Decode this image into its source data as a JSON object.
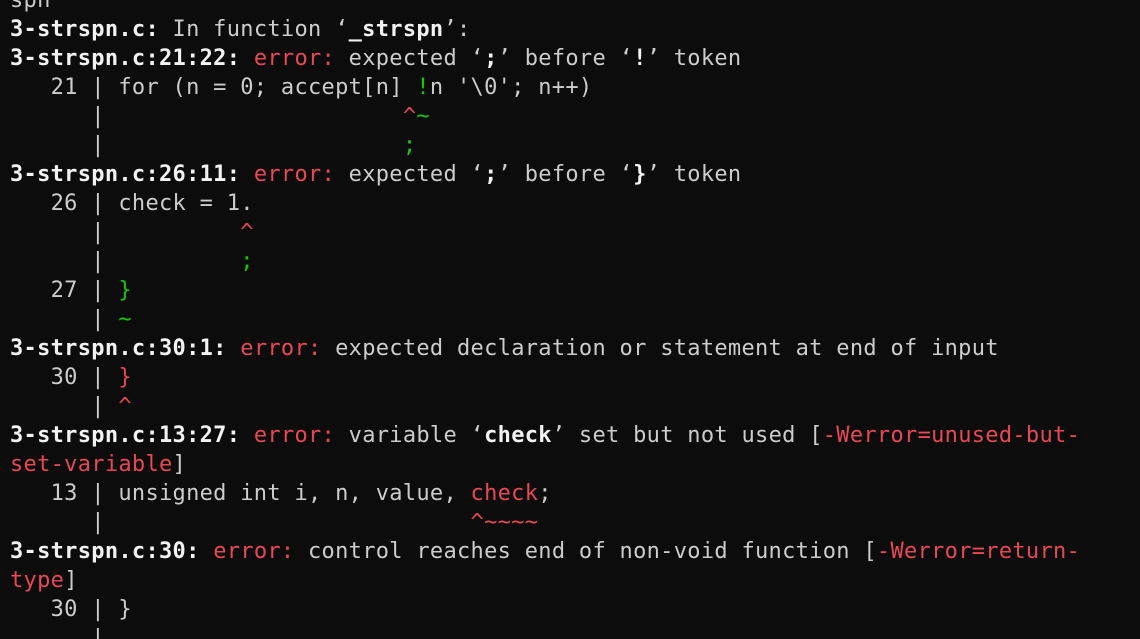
{
  "window": {
    "type": "terminal",
    "colors": {
      "background": "#0c0c0c",
      "text": "#cccccc",
      "error": "#e74856",
      "fixit": "#16c60c",
      "bold": "#f2f2f2"
    }
  },
  "lines": [
    [
      {
        "t": "spn"
      }
    ],
    [
      {
        "t": "3-strspn.c:",
        "c": "b"
      },
      {
        "t": " In function ‘"
      },
      {
        "t": "_strspn",
        "c": "b"
      },
      {
        "t": "’:"
      }
    ],
    [
      {
        "t": "3-strspn.c:21:22:",
        "c": "b"
      },
      {
        "t": " "
      },
      {
        "t": "error:",
        "c": "r"
      },
      {
        "t": " expected ‘"
      },
      {
        "t": ";",
        "c": "b"
      },
      {
        "t": "’ before ‘"
      },
      {
        "t": "!",
        "c": "b"
      },
      {
        "t": "’ token"
      }
    ],
    [
      {
        "t": "   21 | for (n = 0; accept[n] "
      },
      {
        "t": "!",
        "c": "g"
      },
      {
        "t": "n '\\0'; n++)"
      }
    ],
    [
      {
        "t": "      |                      "
      },
      {
        "t": "^",
        "c": "r"
      },
      {
        "t": "~",
        "c": "g"
      }
    ],
    [
      {
        "t": "      |                      "
      },
      {
        "t": ";",
        "c": "g"
      }
    ],
    [
      {
        "t": "3-strspn.c:26:11:",
        "c": "b"
      },
      {
        "t": " "
      },
      {
        "t": "error:",
        "c": "r"
      },
      {
        "t": " expected ‘"
      },
      {
        "t": ";",
        "c": "b"
      },
      {
        "t": "’ before ‘"
      },
      {
        "t": "}",
        "c": "b"
      },
      {
        "t": "’ token"
      }
    ],
    [
      {
        "t": "   26 | check = 1."
      }
    ],
    [
      {
        "t": "      |          "
      },
      {
        "t": "^",
        "c": "r"
      }
    ],
    [
      {
        "t": "      |          "
      },
      {
        "t": ";",
        "c": "g"
      }
    ],
    [
      {
        "t": "   27 | "
      },
      {
        "t": "}",
        "c": "g"
      }
    ],
    [
      {
        "t": "      | "
      },
      {
        "t": "~",
        "c": "g"
      }
    ],
    [
      {
        "t": "3-strspn.c:30:1:",
        "c": "b"
      },
      {
        "t": " "
      },
      {
        "t": "error:",
        "c": "r"
      },
      {
        "t": " expected declaration or statement at end of input"
      }
    ],
    [
      {
        "t": "   30 | "
      },
      {
        "t": "}",
        "c": "r"
      }
    ],
    [
      {
        "t": "      | "
      },
      {
        "t": "^",
        "c": "r"
      }
    ],
    [
      {
        "t": "3-strspn.c:13:27:",
        "c": "b"
      },
      {
        "t": " "
      },
      {
        "t": "error:",
        "c": "r"
      },
      {
        "t": " variable ‘"
      },
      {
        "t": "check",
        "c": "b"
      },
      {
        "t": "’ set but not used ["
      },
      {
        "t": "-Werror=unused-but-",
        "c": "r"
      }
    ],
    [
      {
        "t": "set-variable",
        "c": "r"
      },
      {
        "t": "]"
      }
    ],
    [
      {
        "t": "   13 | unsigned int i, n, value, "
      },
      {
        "t": "check",
        "c": "r"
      },
      {
        "t": ";"
      }
    ],
    [
      {
        "t": "      |                           "
      },
      {
        "t": "^~~~~",
        "c": "r"
      }
    ],
    [
      {
        "t": "3-strspn.c:30:",
        "c": "b"
      },
      {
        "t": " "
      },
      {
        "t": "error:",
        "c": "r"
      },
      {
        "t": " control reaches end of non-void function ["
      },
      {
        "t": "-Werror=return-",
        "c": "r"
      }
    ],
    [
      {
        "t": "type",
        "c": "r"
      },
      {
        "t": "]"
      }
    ],
    [
      {
        "t": "   30 | }"
      }
    ],
    [
      {
        "t": "      |"
      }
    ]
  ]
}
